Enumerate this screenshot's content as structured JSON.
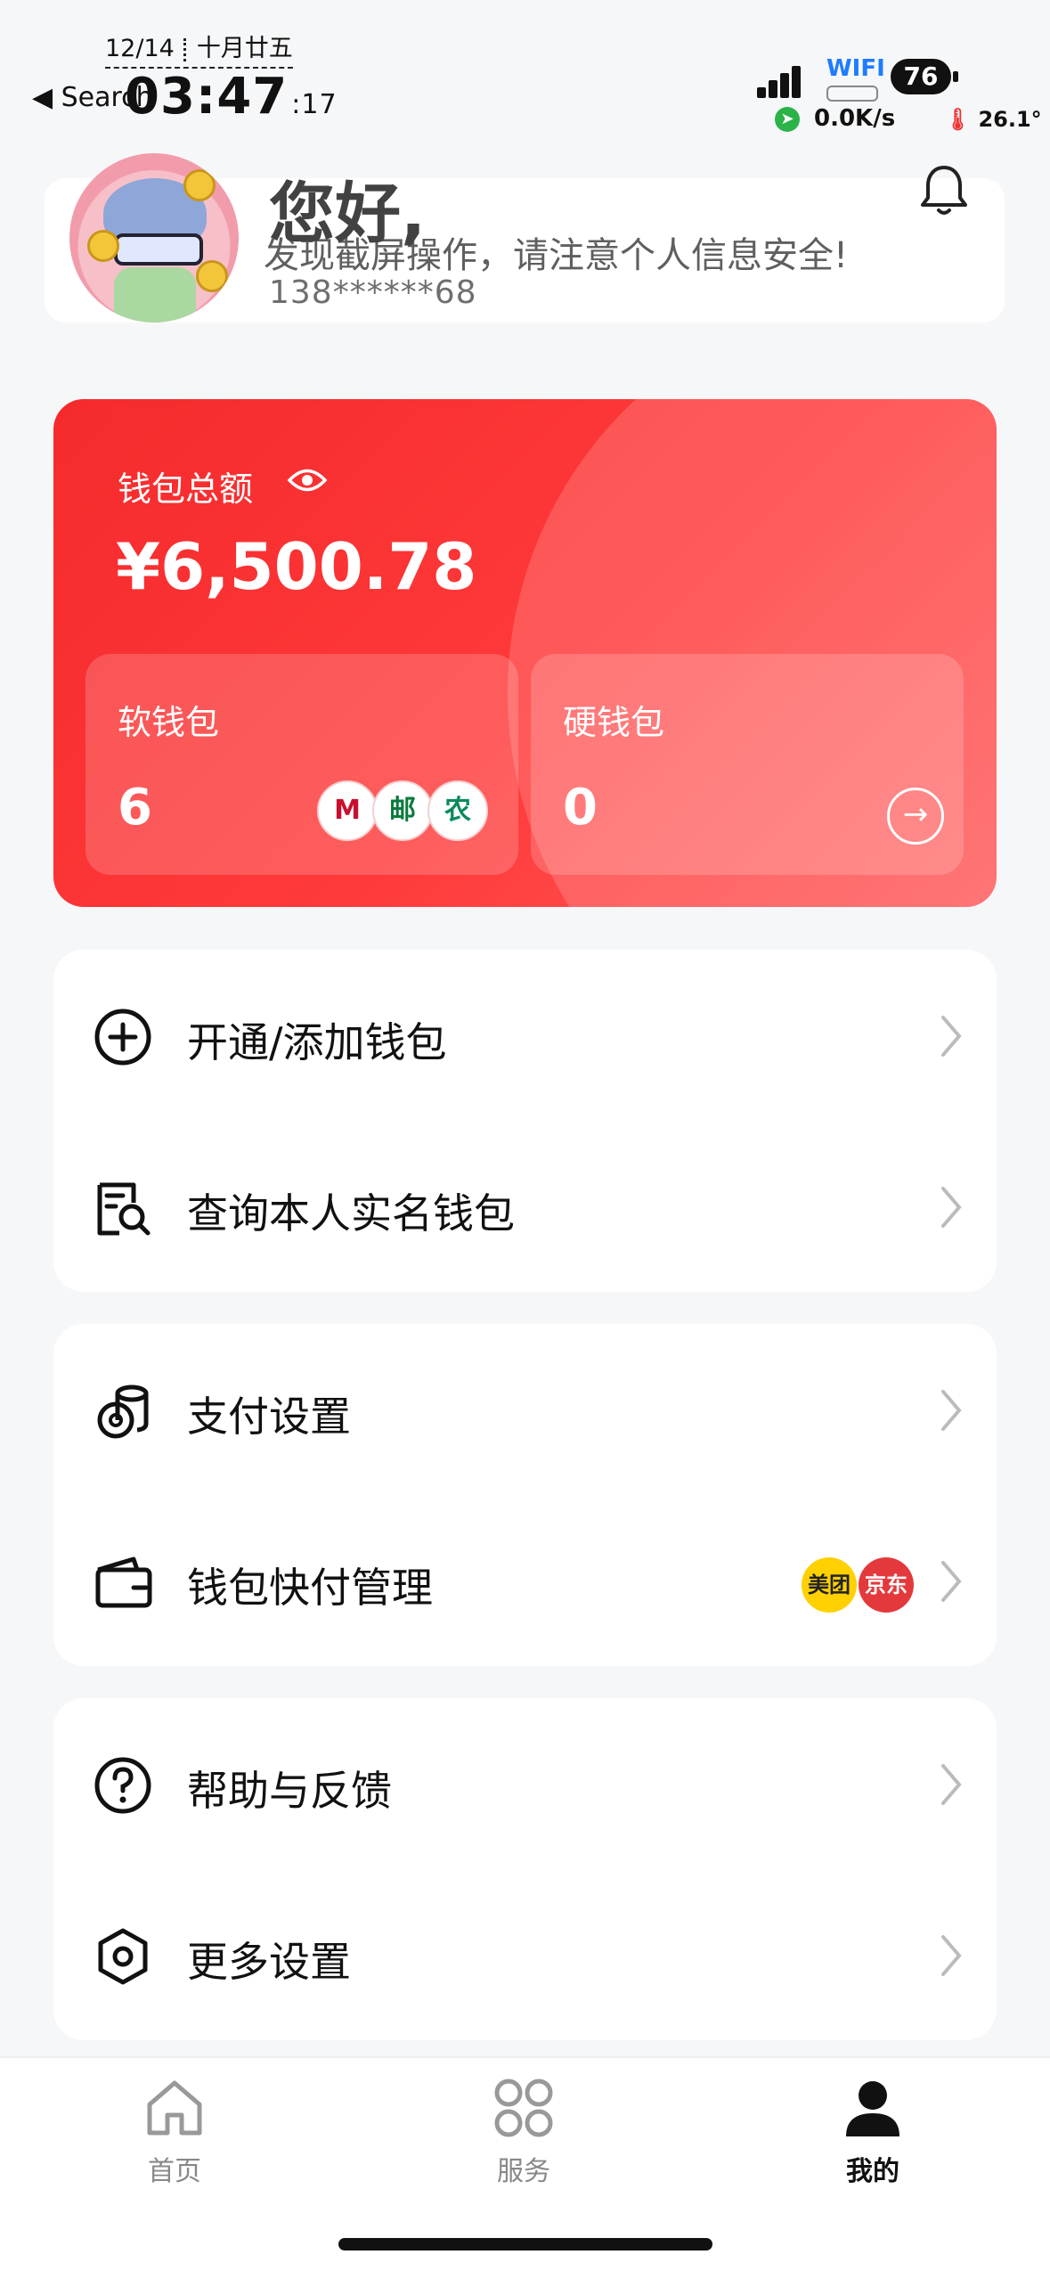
{
  "status": {
    "date": "12/14",
    "lunar": "十月廿五",
    "back_label": "◀ Search",
    "time": "03:47",
    "seconds": ":17",
    "wifi_label": "WIFI",
    "battery": "76",
    "net_speed": "0.0K/s",
    "temperature": "26.1°"
  },
  "greeting": {
    "hello": "您好,",
    "warning": "发现截屏操作，请注意个人信息安全!",
    "phone": "138******68"
  },
  "wallet": {
    "title": "钱包总额",
    "amount": "¥6,500.78",
    "soft_label": "软钱包",
    "soft_count": "6",
    "hard_label": "硬钱包",
    "hard_count": "0",
    "banks": [
      "M",
      "邮",
      "农"
    ]
  },
  "menu": {
    "group1": [
      {
        "label": "开通/添加钱包",
        "icon": "plus-circle-icon"
      },
      {
        "label": "查询本人实名钱包",
        "icon": "search-document-icon"
      }
    ],
    "group2": [
      {
        "label": "支付设置",
        "icon": "coins-icon"
      },
      {
        "label": "钱包快付管理",
        "icon": "wallet-icon",
        "badges": [
          "美团",
          "京东"
        ]
      }
    ],
    "group3": [
      {
        "label": "帮助与反馈",
        "icon": "question-circle-icon"
      },
      {
        "label": "更多设置",
        "icon": "settings-hexagon-icon"
      }
    ]
  },
  "tabs": [
    {
      "label": "首页",
      "icon": "home-icon"
    },
    {
      "label": "服务",
      "icon": "apps-icon"
    },
    {
      "label": "我的",
      "icon": "person-icon",
      "active": true
    }
  ],
  "colors": {
    "accent_red": "#f52a2c",
    "meituan_yellow": "#ffd100",
    "jd_red": "#e4393c"
  }
}
